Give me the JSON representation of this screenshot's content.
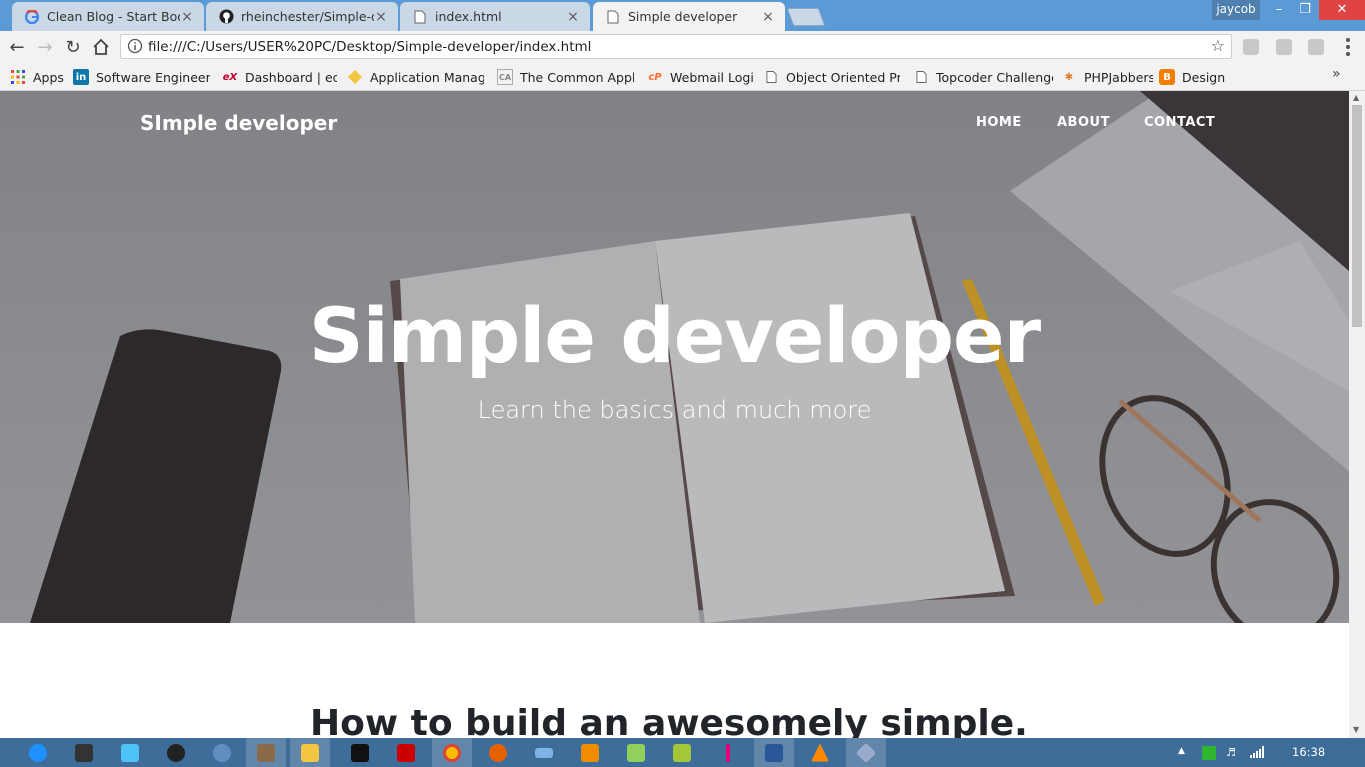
{
  "browser": {
    "tabs": [
      {
        "title": "Clean Blog - Start Bootst",
        "icon": "google-icon",
        "active": false
      },
      {
        "title": "rheinchester/Simple-dev",
        "icon": "github-icon",
        "active": false
      },
      {
        "title": "index.html",
        "icon": "page-icon",
        "active": false
      },
      {
        "title": "Simple developer",
        "icon": "page-icon",
        "active": true
      }
    ],
    "close_glyph": "×",
    "profile_name": "jaycob",
    "address_url": "file:///C:/Users/USER%20PC/Desktop/Simple-developer/index.html",
    "bookmarks": [
      {
        "label": "Apps",
        "icon": "apps-grid-icon"
      },
      {
        "label": "Software Engineering",
        "icon": "linkedin-icon"
      },
      {
        "label": "Dashboard | edX",
        "icon": "edx-icon"
      },
      {
        "label": "Application Managen",
        "icon": "diamond-icon"
      },
      {
        "label": "The Common Applica",
        "icon": "commonapp-icon"
      },
      {
        "label": "Webmail Login",
        "icon": "cpanel-icon"
      },
      {
        "label": "Object Oriented Prog",
        "icon": "page-icon"
      },
      {
        "label": "Topcoder Challenges",
        "icon": "page-icon"
      },
      {
        "label": "PHPJabbers",
        "icon": "phpjabbers-icon"
      },
      {
        "label": "Design",
        "icon": "blogger-icon"
      }
    ],
    "bookmarks_more": "»"
  },
  "page": {
    "brand": "SImple developer",
    "nav": [
      "HOME",
      "ABOUT",
      "CONTACT"
    ],
    "hero_title": "Simple developer",
    "hero_subtitle": "Learn the basics and much more",
    "post_heading": "How to build an awesomely simple."
  },
  "taskbar": {
    "clock": "16:38",
    "apps": [
      "ie-icon",
      "paint-icon",
      "messenger-icon",
      "media-icon",
      "hp-icon",
      "notepad-icon",
      "explorer-icon",
      "cmd-icon",
      "acrobat-icon",
      "chrome-icon",
      "firefox-icon",
      "keyboard-icon",
      "media-player-icon",
      "chat-icon",
      "android-icon",
      "tmobile-icon",
      "word-icon",
      "vlc-icon",
      "git-icon"
    ]
  },
  "colors": {
    "tabstrip": "#5b9bd5",
    "toolbar": "#f2f2f2",
    "taskbar": "#3d6d98",
    "hero_text": "#ffffff"
  }
}
